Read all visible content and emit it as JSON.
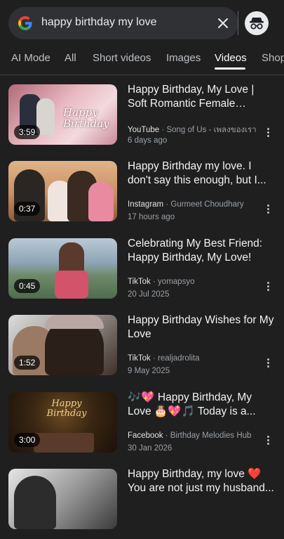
{
  "search": {
    "query": "happy birthday my love"
  },
  "tabs": [
    {
      "label": "AI Mode"
    },
    {
      "label": "All"
    },
    {
      "label": "Short videos"
    },
    {
      "label": "Images"
    },
    {
      "label": "Videos"
    },
    {
      "label": "Shop"
    }
  ],
  "active_tab": "Videos",
  "results": [
    {
      "title": "Happy Birthday, My Love | Soft Romantic Female Versio...",
      "source": "YouTube",
      "channel": "Song of Us - เพลงของเรา",
      "date": "6 days ago",
      "duration": "3:59"
    },
    {
      "title": "Happy Birthday my love. I don't say this enough, but I...",
      "source": "Instagram",
      "channel": "Gurmeet Choudhary",
      "date": "17 hours ago",
      "duration": "0:37"
    },
    {
      "title": "Celebrating My Best Friend: Happy Birthday, My Love!",
      "source": "TikTok",
      "channel": "yomapsyo",
      "date": "20 Jul 2025",
      "duration": "0:45"
    },
    {
      "title": "Happy Birthday Wishes for My Love",
      "source": "TikTok",
      "channel": "realjadrolita",
      "date": "9 May 2025",
      "duration": "1:52"
    },
    {
      "title": "🎶💖 Happy Birthday, My Love 🎂💖🎵 Today is a...",
      "source": "Facebook",
      "channel": "Birthday Melodies Hub",
      "date": "30 Jan 2026",
      "duration": "3:00"
    },
    {
      "title": "Happy Birthday, my love ❤️ You are not just my husband...",
      "source": "",
      "channel": "",
      "date": "",
      "duration": ""
    }
  ],
  "thumb_text": {
    "r0": "Happy Birthday",
    "r4": "Happy Birthday"
  }
}
